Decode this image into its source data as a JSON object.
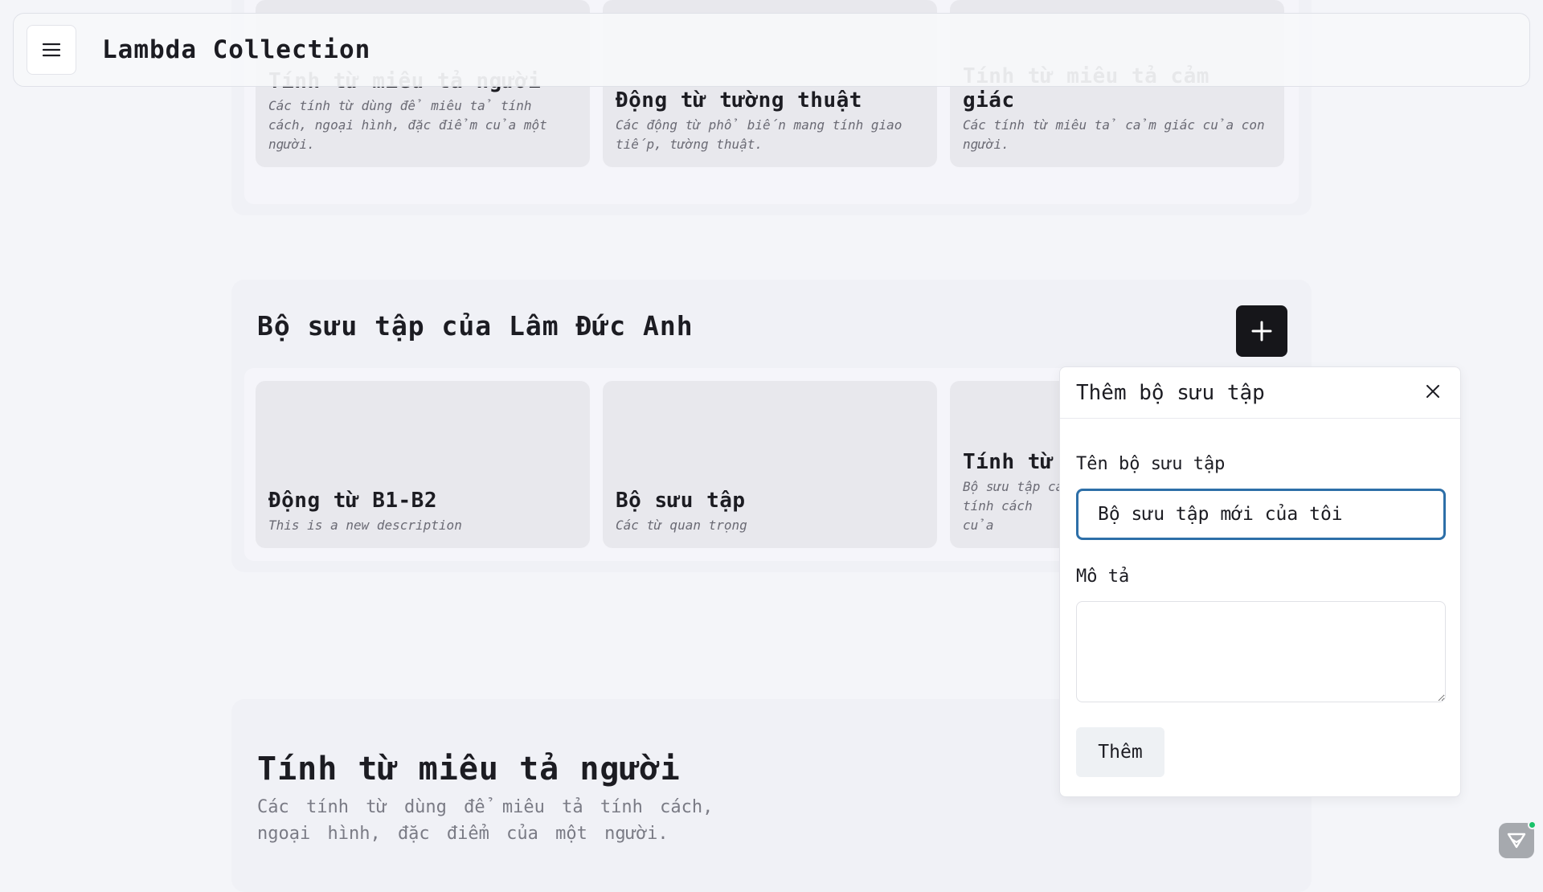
{
  "header": {
    "title": "Lambda Collection"
  },
  "top_section": {
    "cards": [
      {
        "title": "Tính từ miêu tả người",
        "desc": "Các tính từ dùng để miêu tả tính cách, ngoại hình, đặc điểm của một người."
      },
      {
        "title": "Động từ tường thuật",
        "desc": "Các động từ phổ biến mang tính giao tiếp, tường thuật."
      },
      {
        "title": "Tính từ miêu tả cảm giác",
        "desc": "Các tính từ miêu tả cảm giác của con người."
      }
    ]
  },
  "my_section": {
    "heading": "Bộ sưu tập của Lâm Đức Anh",
    "cards": [
      {
        "title": "Động từ B1-B2",
        "desc": "This is a new description"
      },
      {
        "title": "Bộ sưu tập",
        "desc": "Các từ quan trọng"
      },
      {
        "title": "Tính từ",
        "desc": "Bộ sưu tập cá tính cách của"
      }
    ]
  },
  "detail_section": {
    "title": "Tính từ miêu tả người",
    "desc": "Các tính từ dùng để miêu tả tính cách, ngoại hình, đặc điểm của một người."
  },
  "add_form": {
    "title": "Thêm bộ sưu tập",
    "name_label": "Tên bộ sưu tập",
    "name_value": "Bộ sưu tập mới của tôi",
    "desc_label": "Mô tả",
    "desc_value": "",
    "submit_label": "Thêm"
  },
  "icons": {
    "menu": "menu-icon",
    "add": "plus-icon",
    "close": "close-icon",
    "widget": "chat-widget-icon"
  }
}
